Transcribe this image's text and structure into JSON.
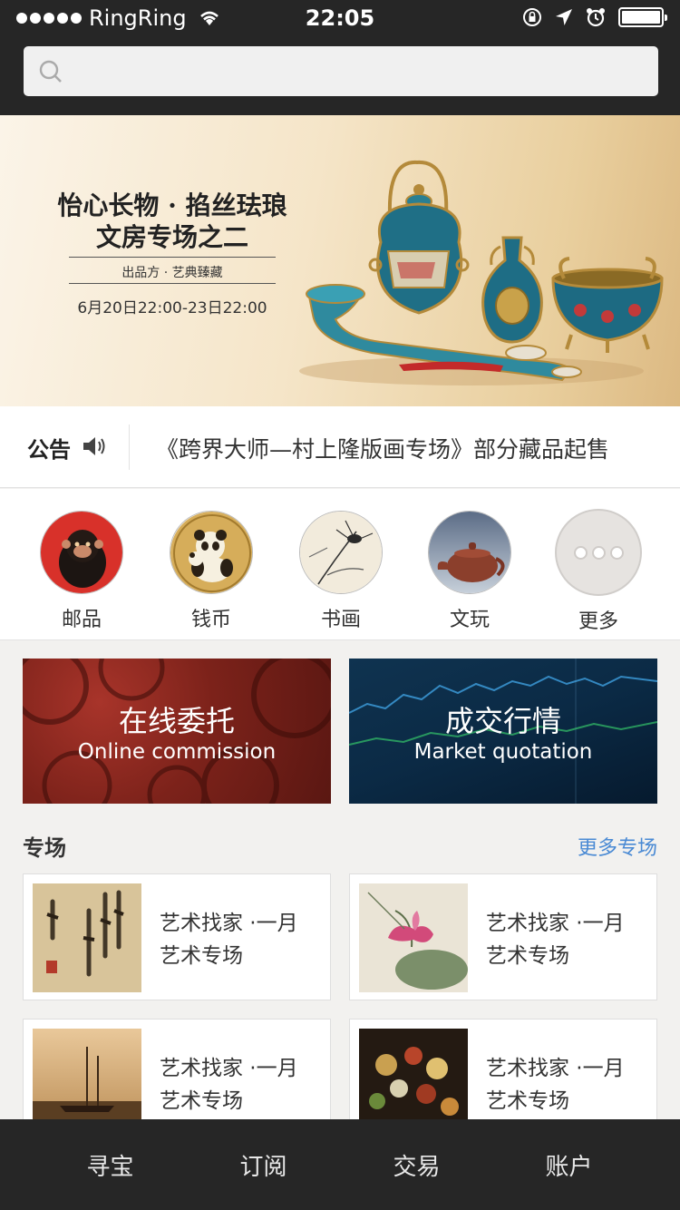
{
  "status_bar": {
    "carrier": "RingRing",
    "time": "22:05"
  },
  "search": {
    "placeholder": ""
  },
  "banner": {
    "title_line1": "怡心长物 · 掐丝珐琅",
    "title_line2": "文房专场之二",
    "subtitle": "出品方 · 艺典臻藏",
    "date_range": "6月20日22:00-23日22:00"
  },
  "notice": {
    "label": "公告",
    "text": "《跨界大师—村上隆版画专场》部分藏品起售"
  },
  "categories": [
    {
      "label": "邮品",
      "icon": "monkey-stamp-icon"
    },
    {
      "label": "钱币",
      "icon": "panda-coin-icon"
    },
    {
      "label": "书画",
      "icon": "painting-icon"
    },
    {
      "label": "文玩",
      "icon": "teapot-icon"
    },
    {
      "label": "更多",
      "icon": "more-dots-icon"
    }
  ],
  "promos": [
    {
      "cn": "在线委托",
      "en": "Online commission"
    },
    {
      "cn": "成交行情",
      "en": "Market quotation"
    }
  ],
  "section": {
    "title": "专场",
    "more": "更多专场"
  },
  "items": [
    {
      "line1": "艺术找家 ·一月",
      "line2": "艺术专场"
    },
    {
      "line1": "艺术找家 ·一月",
      "line2": "艺术专场"
    },
    {
      "line1": "艺术找家 ·一月",
      "line2": "艺术专场"
    },
    {
      "line1": "艺术找家 ·一月",
      "line2": "艺术专场"
    }
  ],
  "tabbar": [
    {
      "label": "寻宝"
    },
    {
      "label": "订阅"
    },
    {
      "label": "交易"
    },
    {
      "label": "账户"
    }
  ],
  "colors": {
    "dark_bar": "#262626",
    "link_blue": "#4a8ad4",
    "page_bg": "#f2f1ef"
  }
}
